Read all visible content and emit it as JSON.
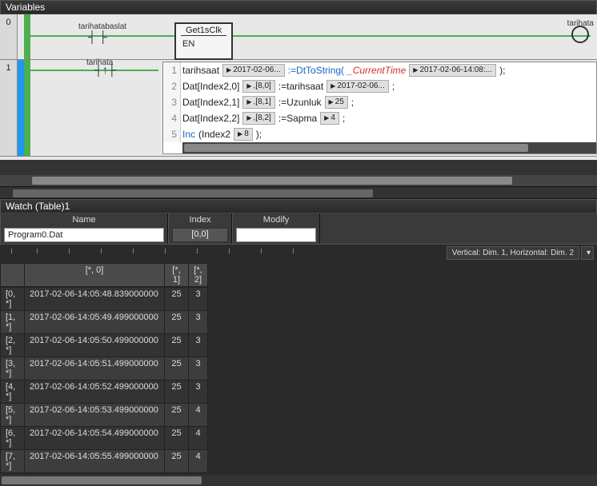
{
  "variablesPanel": {
    "title": "Variables"
  },
  "rungs": [
    {
      "num": "0",
      "contactLabel": "tarihatabaslat",
      "blockTitle": "Get1sClk",
      "blockPort": "EN",
      "coilLabel": "tarihata"
    },
    {
      "num": "1",
      "contactLabel": "tarihata",
      "code": {
        "lines": [
          {
            "n": "1",
            "lhs": "tarihsaat",
            "lhsTip": "2017-02-06...",
            "mid": ":=",
            "fn": "DtToString",
            "arg": "_CurrentTime",
            "rhsTip": "2017-02-06-14:08:...",
            "end": ");"
          },
          {
            "n": "2",
            "lhs": "Dat[Index2,0]",
            "lhsTip": ",[8,0]",
            "mid": ":=tarihsaat",
            "rhsTip": "2017-02-06...",
            "end": ";"
          },
          {
            "n": "3",
            "lhs": "Dat[Index2,1]",
            "lhsTip": ",[8,1]",
            "mid": ":=Uzunluk",
            "rhsTip": "25",
            "end": ";"
          },
          {
            "n": "4",
            "lhs": "Dat[Index2,2]",
            "lhsTip": ",[8,2]",
            "mid": ":=Sapma",
            "rhsTip": "4",
            "end": ";"
          },
          {
            "n": "5",
            "fn": "Inc",
            "lhs": "(Index2",
            "lhsTip": "8",
            "end": ");"
          }
        ]
      }
    }
  ],
  "watch": {
    "title": "Watch (Table)1",
    "cols": {
      "name": {
        "label": "Name",
        "value": "Program0.Dat"
      },
      "index": {
        "label": "Index",
        "value": "[0,0]"
      },
      "modify": {
        "label": "Modify",
        "value": ""
      }
    },
    "dimLabel": "Vertical: Dim. 1, Horizontal: Dim. 2",
    "tableHeaders": [
      "[*, 0]",
      "[*, 1]",
      "[*, 2]"
    ],
    "rows": [
      {
        "idx": "[0, *]",
        "c0": "2017-02-06-14:05:48.839000000",
        "c1": "25",
        "c2": "3"
      },
      {
        "idx": "[1, *]",
        "c0": "2017-02-06-14:05:49.499000000",
        "c1": "25",
        "c2": "3"
      },
      {
        "idx": "[2, *]",
        "c0": "2017-02-06-14:05:50.499000000",
        "c1": "25",
        "c2": "3"
      },
      {
        "idx": "[3, *]",
        "c0": "2017-02-06-14:05:51.499000000",
        "c1": "25",
        "c2": "3"
      },
      {
        "idx": "[4, *]",
        "c0": "2017-02-06-14:05:52.499000000",
        "c1": "25",
        "c2": "3"
      },
      {
        "idx": "[5, *]",
        "c0": "2017-02-06-14:05:53.499000000",
        "c1": "25",
        "c2": "4"
      },
      {
        "idx": "[6, *]",
        "c0": "2017-02-06-14:05:54.499000000",
        "c1": "25",
        "c2": "4"
      },
      {
        "idx": "[7, *]",
        "c0": "2017-02-06-14:05:55.499000000",
        "c1": "25",
        "c2": "4"
      }
    ]
  }
}
